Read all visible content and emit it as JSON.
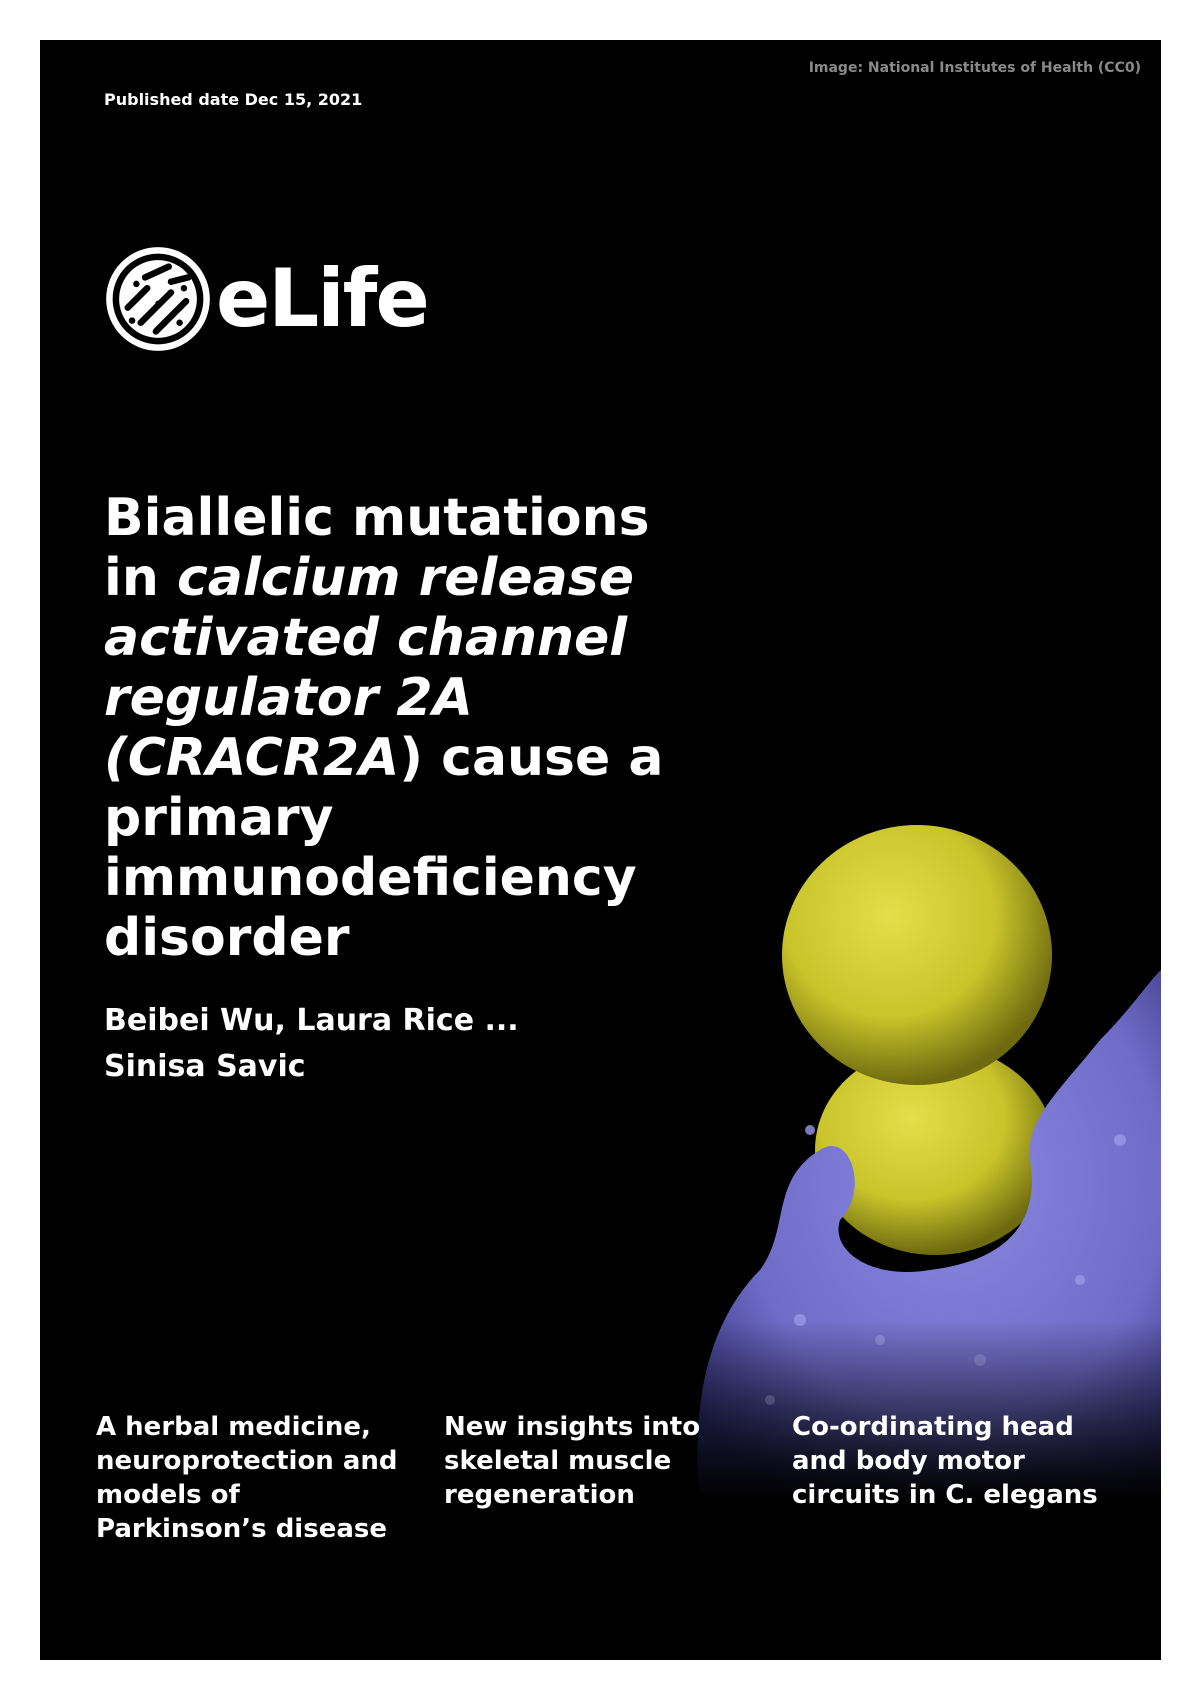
{
  "cover": {
    "image_credit": "Image: National Institutes of Health (CC0)",
    "published": "Published date Dec 15, 2021",
    "logo_text": "eLife",
    "title_parts": {
      "p1": "Biallelic mutations in ",
      "p2": "calcium release activated channel regulator 2A (CRACR2A",
      "p3": ") cause a primary immunodeficiency disorder"
    },
    "authors_line1": "Beibei Wu, Laura Rice ...",
    "authors_line2": "Sinisa Savic",
    "teasers": [
      "A herbal medicine, neuroprotection and models of Parkinson’s disease",
      "New insights into skeletal muscle regeneration",
      "Co-ordinating head and body motor circuits in C. elegans"
    ]
  },
  "colors": {
    "background": "#000000",
    "text": "#ffffff",
    "bacteria": "#c9c42a",
    "cell": "#6f6cc8"
  }
}
